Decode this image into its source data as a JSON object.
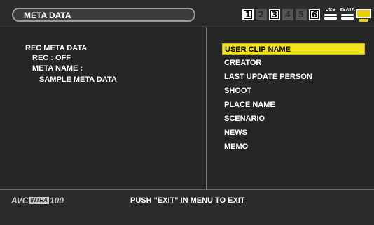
{
  "header": {
    "title": "META DATA",
    "slots": [
      {
        "label": "1",
        "active": true
      },
      {
        "label": "2",
        "active": false
      },
      {
        "label": "3",
        "active": true
      },
      {
        "label": "4",
        "active": false
      },
      {
        "label": "5",
        "active": false
      },
      {
        "label": "6",
        "active": true
      }
    ],
    "drives": [
      {
        "label": "USB",
        "icon": "usb-drive-icon"
      },
      {
        "label": "eSATA",
        "icon": "esata-drive-icon"
      }
    ],
    "monitor_icon": "monitor-icon",
    "monitor_color": "#e8d200"
  },
  "left_panel": {
    "heading": "REC META DATA",
    "rec_status": "REC : OFF",
    "meta_name_label": "META NAME :",
    "meta_name_value": "SAMPLE META DATA"
  },
  "menu": {
    "selected_index": 0,
    "selected_color": "#f2e21a",
    "items": [
      "USER CLIP NAME",
      "CREATOR",
      "LAST UPDATE PERSON",
      "SHOOT",
      "PLACE NAME",
      "SCENARIO",
      "NEWS",
      "MEMO"
    ]
  },
  "footer": {
    "logo_prefix": "AVC",
    "logo_badge": "INTRA",
    "logo_suffix": "100",
    "message": "PUSH \"EXIT\" IN MENU TO EXIT"
  }
}
